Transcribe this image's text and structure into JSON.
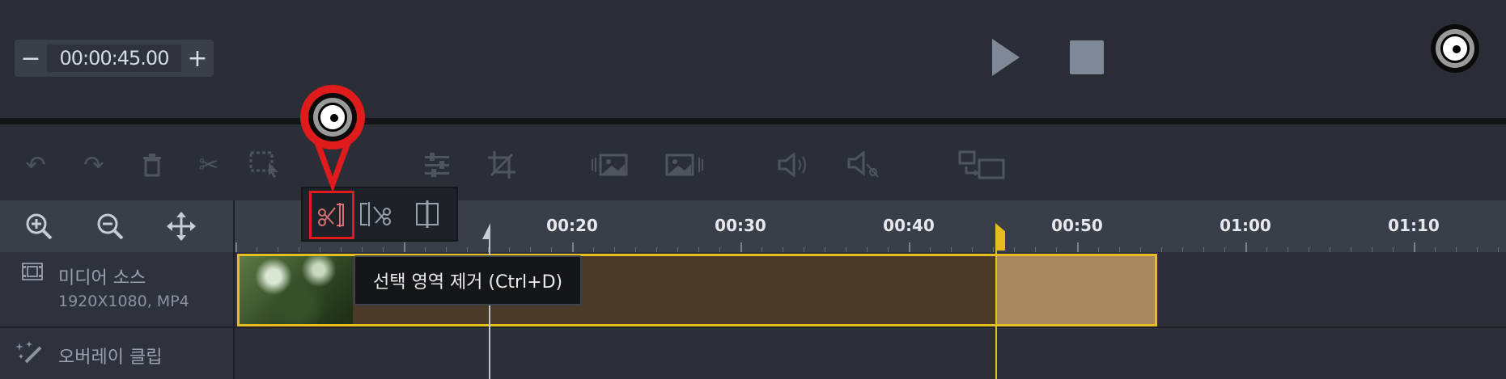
{
  "player": {
    "time_minus_label": "−",
    "time_value": "00:00:45.00",
    "time_plus_label": "+"
  },
  "toolbar": {
    "icons": [
      "undo-icon",
      "redo-icon",
      "delete-icon",
      "cut-icon",
      "select-area-icon",
      "split-icon",
      "adjust-icon",
      "crop-icon",
      "image-fit-icon",
      "image-icon",
      "volume-icon",
      "mute-icon",
      "replace-icon"
    ]
  },
  "timeline": {
    "ticks": [
      "00:20",
      "00:30",
      "00:40",
      "00:50",
      "01:00",
      "01:10"
    ]
  },
  "split_menu": {
    "tooltip": "선택 영역 제거 (Ctrl+D)"
  },
  "tracks": [
    {
      "name": "미디어 소스",
      "meta": "1920X1080, MP4"
    },
    {
      "name": "오버레이 클립"
    }
  ],
  "colors": {
    "accent_yellow": "#e7be22",
    "callout_red": "#e01b1b"
  }
}
